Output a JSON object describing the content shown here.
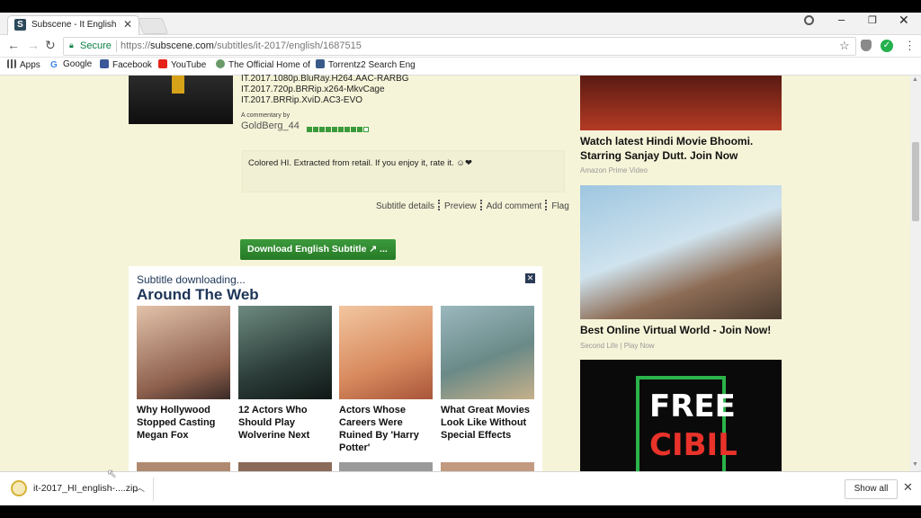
{
  "browser": {
    "tab_title": "Subscene - It English he",
    "favicon_letter": "S",
    "url_secure_label": "Secure",
    "url_scheme": "https://",
    "url_host": "subscene.com",
    "url_path": "/subtitles/it-2017/english/1687515",
    "bookmarks": [
      "Apps",
      "Google",
      "Facebook",
      "YouTube",
      "The Official Home of",
      "Torrentz2 Search Eng"
    ]
  },
  "subtitle": {
    "releases": [
      "IT.2017.1080p.BluRay.H264.AAC-RARBG",
      "IT.2017.720p.BRRip.x264-MkvCage",
      "IT.2017.BRRip.XviD.AC3-EVO"
    ],
    "commentary_by": "A commentary by",
    "author": "GoldBerg_44",
    "rating": {
      "filled": 9,
      "total": 10
    },
    "comment": "Colored HI. Extracted from retail. If you enjoy it, rate it. ☺❤",
    "links": [
      "Subtitle details",
      "Preview",
      "Add comment",
      "Flag"
    ],
    "download_label": "Download English Subtitle ↗ ..."
  },
  "widget": {
    "subtitle": "Subtitle downloading...",
    "title": "Around The Web",
    "close": "✕",
    "cards": [
      {
        "title": "Why Hollywood Stopped Casting Megan Fox",
        "color": "#b58a74"
      },
      {
        "title": "12 Actors Who Should Play Wolverine Next",
        "color": "#3b5048"
      },
      {
        "title": "Actors Whose Careers Were Ruined By 'Harry Potter'",
        "color": "#d89a6f"
      },
      {
        "title": "What Great Movies Look Like Without Special Effects",
        "color": "#7fa0a8"
      }
    ]
  },
  "ads": [
    {
      "title": "Watch latest Hindi Movie Bhoomi. Starring Sanjay Dutt. Join Now",
      "source": "Amazon Prime Video"
    },
    {
      "title": "Best Online Virtual World - Join Now!",
      "source": "Second Life | Play Now"
    },
    {
      "banner_line1": "FREE",
      "banner_line2": "CIBIL"
    }
  ],
  "downloads": {
    "file_name": "it-2017_HI_english-....zip",
    "show_all": "Show all"
  }
}
